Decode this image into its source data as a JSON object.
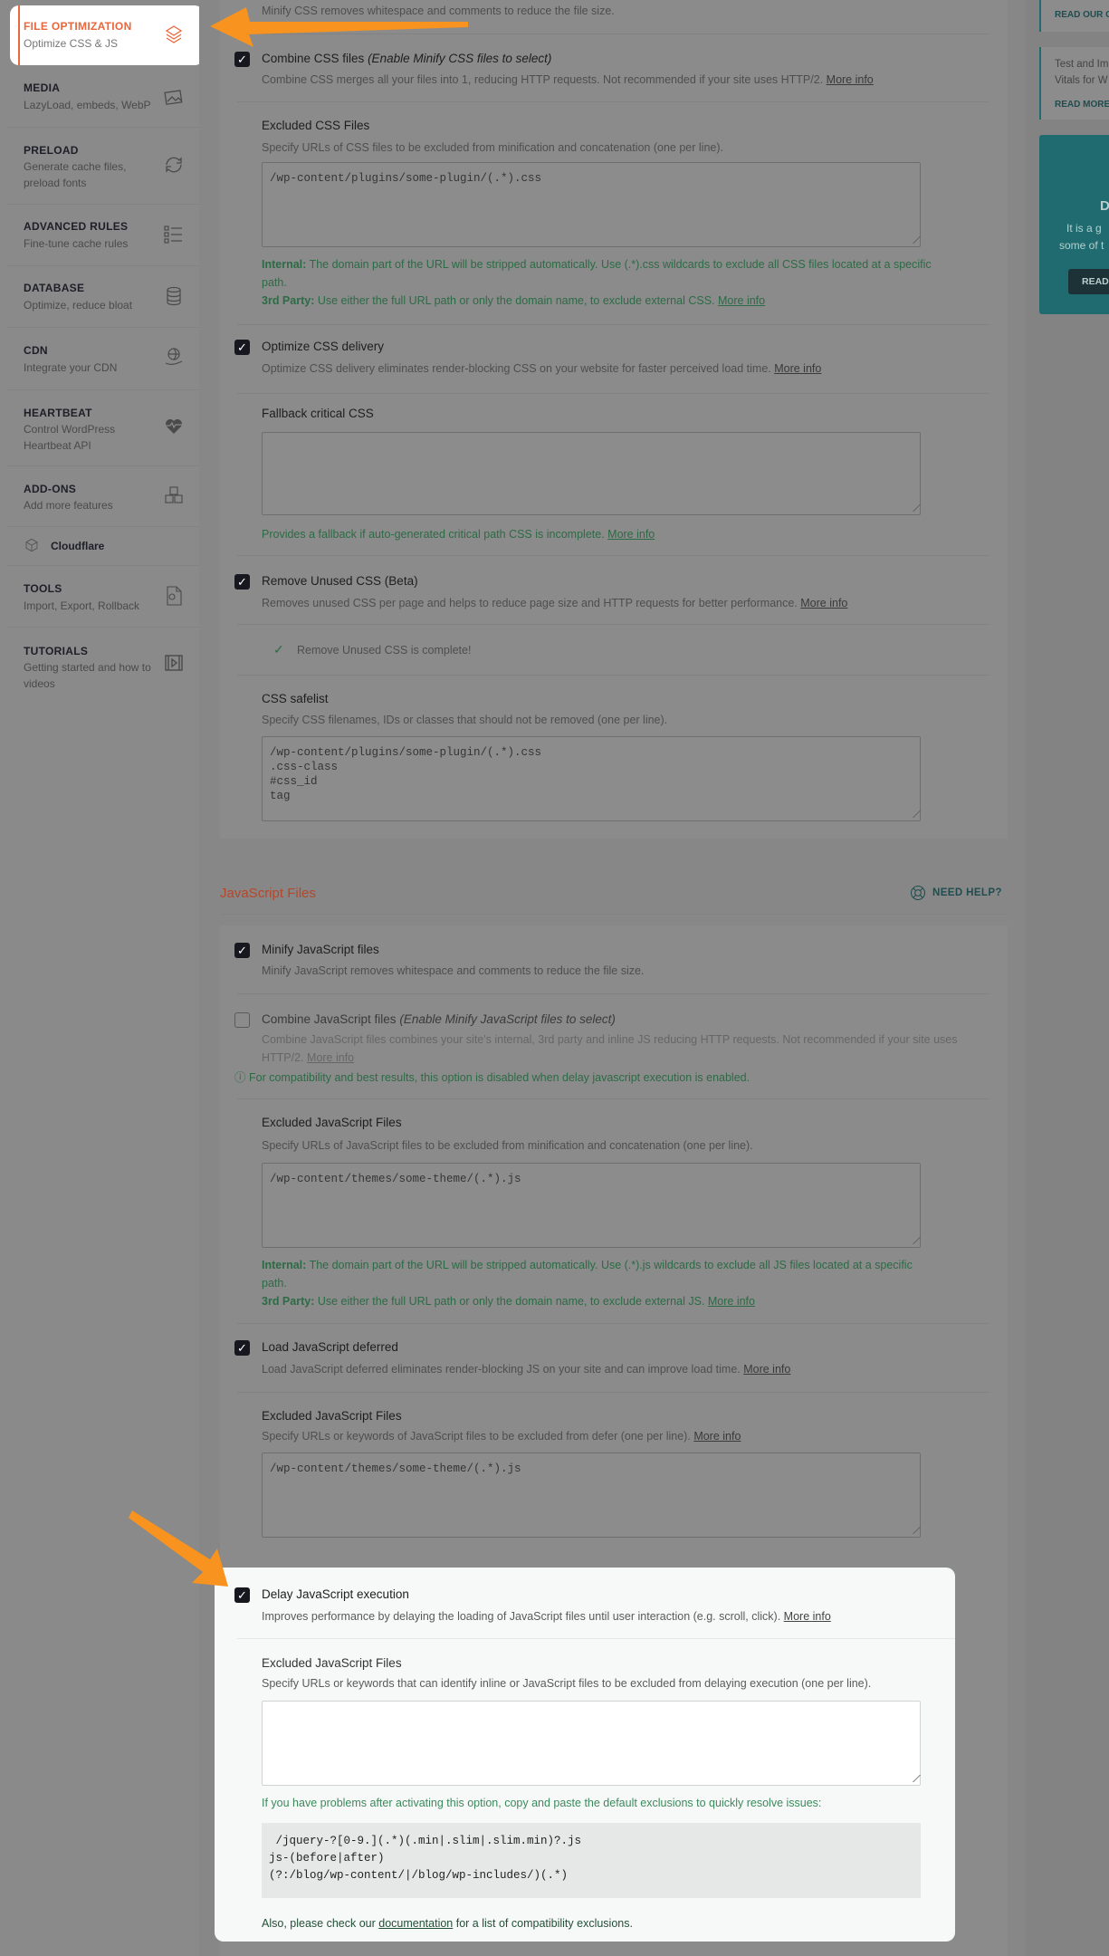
{
  "sidebar": {
    "items": [
      {
        "title": "FILE OPTIMIZATION",
        "subtitle": "Optimize CSS & JS",
        "icon": "layers-icon",
        "active": true
      },
      {
        "title": "MEDIA",
        "subtitle": "LazyLoad, embeds, WebP",
        "icon": "image-icon"
      },
      {
        "title": "PRELOAD",
        "subtitle": "Generate cache files, preload fonts",
        "icon": "refresh-icon"
      },
      {
        "title": "ADVANCED RULES",
        "subtitle": "Fine-tune cache rules",
        "icon": "checklist-icon"
      },
      {
        "title": "DATABASE",
        "subtitle": "Optimize, reduce bloat",
        "icon": "database-icon"
      },
      {
        "title": "CDN",
        "subtitle": "Integrate your CDN",
        "icon": "globe-hand-icon"
      },
      {
        "title": "HEARTBEAT",
        "subtitle": "Control WordPress Heartbeat API",
        "icon": "heartbeat-icon"
      },
      {
        "title": "ADD-ONS",
        "subtitle": "Add more features",
        "icon": "cubes-icon"
      },
      {
        "title": "Cloudflare",
        "icon": "cube-icon"
      },
      {
        "title": "TOOLS",
        "subtitle": "Import, Export, Rollback",
        "icon": "file-gear-icon"
      },
      {
        "title": "TUTORIALS",
        "subtitle": "Getting started and how to videos",
        "icon": "video-icon"
      }
    ]
  },
  "css": {
    "minify_desc": "Minify CSS removes whitespace and comments to reduce the file size.",
    "combine": {
      "label": "Combine CSS files",
      "label_note": "(Enable Minify CSS files to select)",
      "desc": "Combine CSS merges all your files into 1, reducing HTTP requests. Not recommended if your site uses HTTP/2.",
      "more": "More info",
      "checked": true
    },
    "excluded": {
      "label": "Excluded CSS Files",
      "desc": "Specify URLs of CSS files to be excluded from minification and concatenation (one per line).",
      "value": "/wp-content/plugins/some-plugin/(.*).css",
      "internal_label": "Internal:",
      "internal_text": "The domain part of the URL will be stripped automatically. Use (.*).css wildcards to exclude all CSS files located at a specific path.",
      "third_label": "3rd Party:",
      "third_text": "Use either the full URL path or only the domain name, to exclude external CSS.",
      "more": "More info"
    },
    "optimize": {
      "label": "Optimize CSS delivery",
      "desc": "Optimize CSS delivery eliminates render-blocking CSS on your website for faster perceived load time.",
      "more": "More info",
      "checked": true
    },
    "fallback": {
      "label": "Fallback critical CSS",
      "value": "",
      "help": "Provides a fallback if auto-generated critical path CSS is incomplete.",
      "more": "More info"
    },
    "rucss": {
      "label": "Remove Unused CSS (Beta)",
      "desc": "Removes unused CSS per page and helps to reduce page size and HTTP requests for better performance.",
      "more": "More info",
      "checked": true,
      "status": "Remove Unused CSS is complete!"
    },
    "safelist": {
      "label": "CSS safelist",
      "desc": "Specify CSS filenames, IDs or classes that should not be removed (one per line).",
      "value": "/wp-content/plugins/some-plugin/(.*).css\n.css-class\n#css_id\ntag"
    }
  },
  "js": {
    "section_title": "JavaScript Files",
    "need_help": "NEED HELP?",
    "minify": {
      "label": "Minify JavaScript files",
      "desc": "Minify JavaScript removes whitespace and comments to reduce the file size.",
      "checked": true
    },
    "combine": {
      "label": "Combine JavaScript files",
      "label_note": "(Enable Minify JavaScript files to select)",
      "desc": "Combine JavaScript files combines your site's internal, 3rd party and inline JS reducing HTTP requests. Not recommended if your site uses HTTP/2.",
      "more": "More info",
      "checked": false,
      "notice": "For compatibility and best results, this option is disabled when delay javascript execution is enabled."
    },
    "excluded": {
      "label": "Excluded JavaScript Files",
      "desc": "Specify URLs of JavaScript files to be excluded from minification and concatenation (one per line).",
      "value": "/wp-content/themes/some-theme/(.*).js",
      "internal_label": "Internal:",
      "internal_text": "The domain part of the URL will be stripped automatically. Use (.*).js wildcards to exclude all JS files located at a specific path.",
      "third_label": "3rd Party:",
      "third_text": "Use either the full URL path or only the domain name, to exclude external JS.",
      "more": "More info"
    },
    "defer": {
      "label": "Load JavaScript deferred",
      "desc": "Load JavaScript deferred eliminates render-blocking JS on your site and can improve load time.",
      "more": "More info",
      "checked": true
    },
    "defer_excluded": {
      "label": "Excluded JavaScript Files",
      "desc": "Specify URLs or keywords of JavaScript files to be excluded from defer (one per line).",
      "more": "More info",
      "value": "/wp-content/themes/some-theme/(.*).js"
    },
    "delay": {
      "label": "Delay JavaScript execution",
      "desc": "Improves performance by delaying the loading of JavaScript files until user interaction (e.g. scroll, click).",
      "more": "More info",
      "checked": true
    },
    "delay_excluded": {
      "label": "Excluded JavaScript Files",
      "desc": "Specify URLs or keywords that can identify inline or JavaScript files to be excluded from delaying execution (one per line).",
      "value": "",
      "help": "If you have problems after activating this option, copy and paste the default exclusions to quickly resolve issues:",
      "defaults": " /jquery-?[0-9.](.*)(.min|.slim|.slim.min)?.js\njs-(before|after)\n(?:/blog/wp-content/|/blog/wp-includes/)(.*)",
      "also_pre": "Also, please check our",
      "also_link": "documentation",
      "also_post": "for a list of compatibility exclusions."
    }
  },
  "right": {
    "box1_link": "READ OUR G",
    "box2_text1": "Test and Im",
    "box2_text2": "Vitals for W",
    "box2_link": "READ MORE",
    "promo_title": "D",
    "promo_text1": "It is a g",
    "promo_text2": "some of t",
    "promo_button": "READ"
  },
  "colors": {
    "accent": "#e8673c",
    "annotation_arrow": "#f7931e",
    "teal": "#1f6b6f",
    "green_text": "#2c6b45"
  }
}
